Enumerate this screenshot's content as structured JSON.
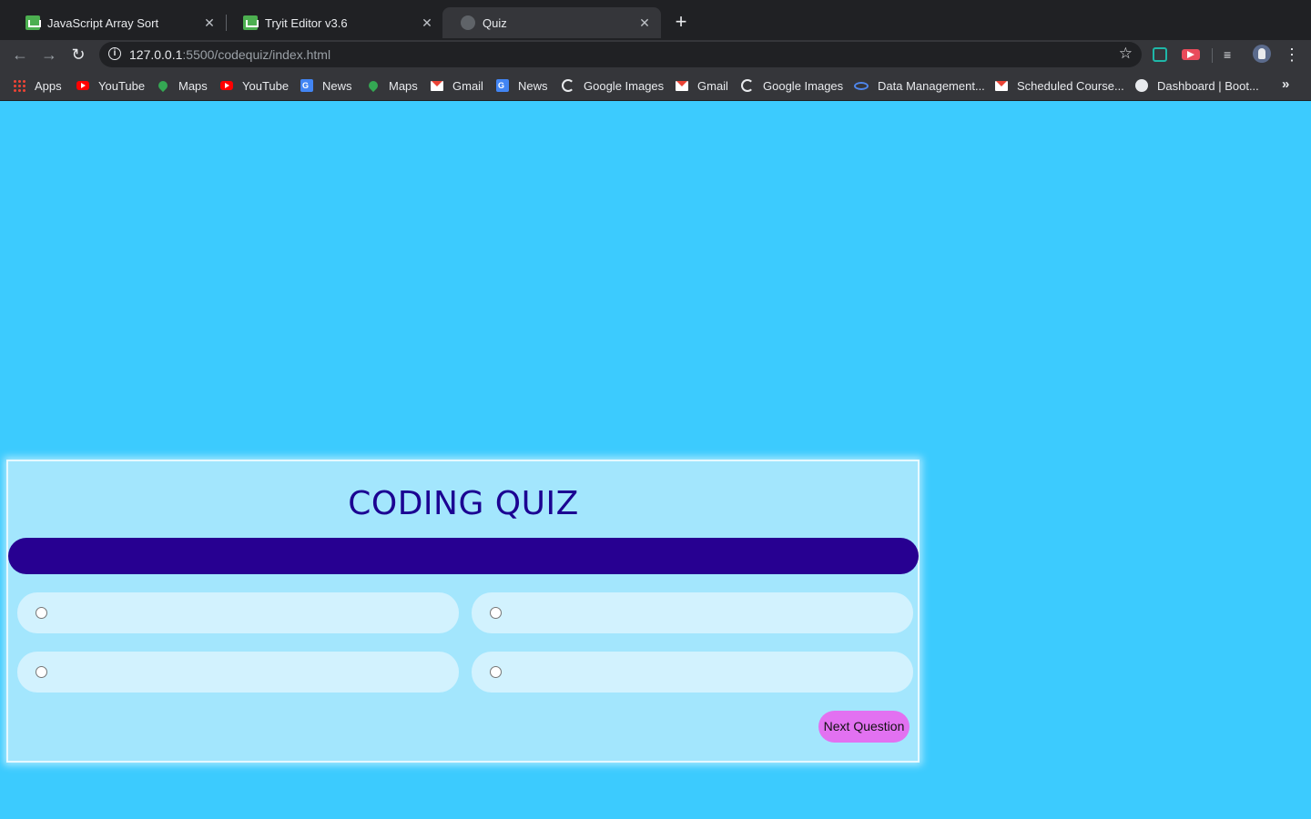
{
  "browser": {
    "tabs": [
      {
        "title": "JavaScript Array Sort",
        "favicon": "w3schools-icon",
        "active": false
      },
      {
        "title": "Tryit Editor v3.6",
        "favicon": "w3schools-icon",
        "active": false
      },
      {
        "title": "Quiz",
        "favicon": "globe-icon",
        "active": true
      }
    ],
    "tab_close_glyph": "✕",
    "new_tab_glyph": "+",
    "url_host": "127.0.0.1",
    "url_path": ":5500/codequiz/index.html",
    "bookmarks": [
      {
        "label": "Apps",
        "icon": "apps-grid-icon"
      },
      {
        "label": "YouTube",
        "icon": "youtube-icon"
      },
      {
        "label": "Maps",
        "icon": "maps-icon"
      },
      {
        "label": "YouTube",
        "icon": "youtube-icon"
      },
      {
        "label": "News",
        "icon": "google-news-icon"
      },
      {
        "label": "Maps",
        "icon": "maps-icon"
      },
      {
        "label": "Gmail",
        "icon": "gmail-icon"
      },
      {
        "label": "News",
        "icon": "google-news-icon"
      },
      {
        "label": "Google Images",
        "icon": "google-icon"
      },
      {
        "label": "Gmail",
        "icon": "gmail-icon"
      },
      {
        "label": "Google Images",
        "icon": "google-icon"
      },
      {
        "label": "Data Management...",
        "icon": "infinity-icon"
      },
      {
        "label": "Scheduled Course...",
        "icon": "gmail-icon"
      },
      {
        "label": "Dashboard | Boot...",
        "icon": "globe-icon"
      }
    ]
  },
  "page": {
    "background": "#3ccbfe",
    "quiz": {
      "title": "CODING QUIZ",
      "question": "",
      "options": [
        "",
        "",
        "",
        ""
      ],
      "next_button": "Next Question",
      "accent": "#270091",
      "button_color": "#e271f1"
    }
  }
}
